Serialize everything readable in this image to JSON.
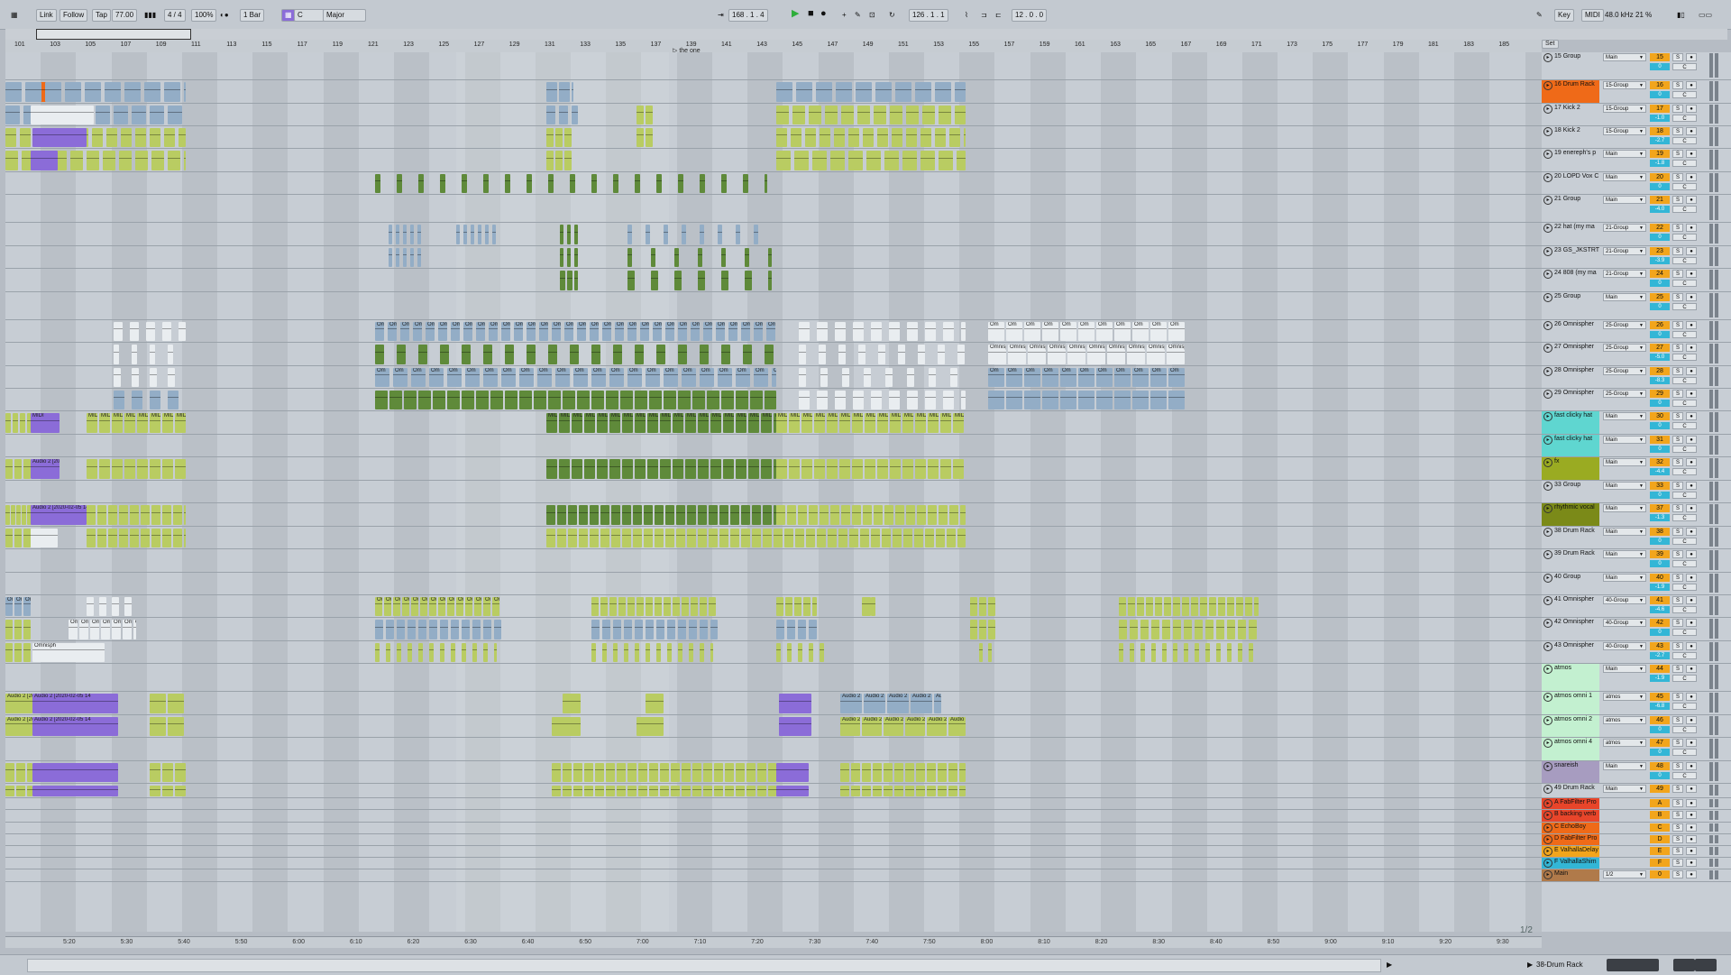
{
  "app": "Ableton Live",
  "toolbar": {
    "link": "Link",
    "follow": "Follow",
    "tap": "Tap",
    "tempo": "77.00",
    "time_sig": "4 / 4",
    "zoom": "100%",
    "quant": "1 Bar",
    "key": "C",
    "scale": "Major",
    "position": "168 . 1 . 4",
    "loop_start": "126 . 1 . 1",
    "loop_len": "12 . 0 . 0",
    "key_label": "Key",
    "midi_label": "MIDI",
    "sample_rate": "48.0 kHz",
    "cpu": "21 %"
  },
  "ruler": {
    "bars": [
      "101",
      "103",
      "105",
      "107",
      "109",
      "111",
      "113",
      "115",
      "117",
      "119",
      "121",
      "123",
      "125",
      "127",
      "129",
      "131",
      "133",
      "135",
      "137",
      "139",
      "141",
      "143",
      "145",
      "147",
      "149",
      "151",
      "153",
      "155",
      "157",
      "159",
      "161",
      "163",
      "165",
      "167",
      "169",
      "171",
      "173",
      "175",
      "177",
      "179",
      "181",
      "183",
      "185"
    ],
    "set_label": "Set",
    "marker": "the one"
  },
  "time_ruler": [
    "5:20",
    "5:30",
    "5:40",
    "5:50",
    "6:00",
    "6:10",
    "6:20",
    "6:30",
    "6:40",
    "6:50",
    "7:00",
    "7:10",
    "7:20",
    "7:30",
    "7:40",
    "7:50",
    "8:00",
    "8:10",
    "8:20",
    "8:30",
    "8:40",
    "8:50",
    "9:00",
    "9:10",
    "9:20",
    "9:30"
  ],
  "page_fraction": "1/2",
  "tracks": [
    {
      "name": "15 Group",
      "route": "Main",
      "num": "15",
      "vol": "0",
      "color": "#c8ced5"
    },
    {
      "name": "16 Drum Rack",
      "route": "15-Group",
      "num": "16",
      "vol": "0",
      "color": "#ef6a18"
    },
    {
      "name": "17 Kick 2",
      "route": "15-Group",
      "num": "17",
      "vol": "-1.0",
      "color": "#c8ced5"
    },
    {
      "name": "18 Kick 2",
      "route": "15-Group",
      "num": "18",
      "vol": "-2.7",
      "color": "#c8ced5"
    },
    {
      "name": "19 enereph's p",
      "route": "Main",
      "num": "19",
      "vol": "-1.8",
      "color": "#c8ced5"
    },
    {
      "name": "20 LOPD  Vox C",
      "route": "Main",
      "num": "20",
      "vol": "0",
      "color": "#c8ced5"
    },
    {
      "name": "21 Group",
      "route": "Main",
      "num": "21",
      "vol": "-4.0",
      "color": "#c8ced5"
    },
    {
      "name": "22 hat (my ma",
      "route": "21-Group",
      "num": "22",
      "vol": "0",
      "color": "#c8ced5"
    },
    {
      "name": "23 GS_JKSTRT",
      "route": "21-Group",
      "num": "23",
      "vol": "-3.9",
      "color": "#c8ced5"
    },
    {
      "name": "24 808 (my ma",
      "route": "21-Group",
      "num": "24",
      "vol": "0",
      "color": "#c8ced5"
    },
    {
      "name": "25 Group",
      "route": "Main",
      "num": "25",
      "vol": "0",
      "color": "#c8ced5"
    },
    {
      "name": "26 Omnispher",
      "route": "25-Group",
      "num": "26",
      "vol": "0",
      "color": "#c8ced5"
    },
    {
      "name": "27 Omnispher",
      "route": "25-Group",
      "num": "27",
      "vol": "-5.0",
      "color": "#c8ced5"
    },
    {
      "name": "28 Omnispher",
      "route": "25-Group",
      "num": "28",
      "vol": "-8.3",
      "color": "#c8ced5"
    },
    {
      "name": "29 Omnispher",
      "route": "25-Group",
      "num": "29",
      "vol": "0",
      "color": "#c8ced5"
    },
    {
      "name": "fast clicky hat",
      "route": "Main",
      "num": "30",
      "vol": "0",
      "color": "#5fd6d0"
    },
    {
      "name": "fast clicky hat",
      "route": "Main",
      "num": "31",
      "vol": "0",
      "color": "#5fd6d0"
    },
    {
      "name": "fx",
      "route": "Main",
      "num": "32",
      "vol": "-4.4",
      "color": "#9aab22"
    },
    {
      "name": "33 Group",
      "route": "Main",
      "num": "33",
      "vol": "0",
      "color": "#c8ced5"
    },
    {
      "name": "rhythmic vocal",
      "route": "Main",
      "num": "37",
      "vol": "-1.3",
      "color": "#7b8a18"
    },
    {
      "name": "38 Drum Rack",
      "route": "Main",
      "num": "38",
      "vol": "0",
      "color": "#c8ced5"
    },
    {
      "name": "39 Drum Rack",
      "route": "Main",
      "num": "39",
      "vol": "0",
      "color": "#c8ced5"
    },
    {
      "name": "40 Group",
      "route": "Main",
      "num": "40",
      "vol": "-1.9",
      "color": "#c8ced5"
    },
    {
      "name": "41 Omnispher",
      "route": "40-Group",
      "num": "41",
      "vol": "-4.6",
      "color": "#c8ced5"
    },
    {
      "name": "42 Omnispher",
      "route": "40-Group",
      "num": "42",
      "vol": "0",
      "color": "#c8ced5"
    },
    {
      "name": "43 Omnispher",
      "route": "40-Group",
      "num": "43",
      "vol": "-2.7",
      "color": "#c8ced5"
    },
    {
      "name": "atmos",
      "route": "Main",
      "num": "44",
      "vol": "-1.9",
      "color": "#c3f0d0"
    },
    {
      "name": "atmos omni 1",
      "route": "atmos",
      "num": "45",
      "vol": "-6.8",
      "color": "#c3f0d0"
    },
    {
      "name": "atmos omni 2",
      "route": "atmos",
      "num": "46",
      "vol": "0",
      "color": "#c3f0d0"
    },
    {
      "name": "atmos omni 4",
      "route": "atmos",
      "num": "47",
      "vol": "0",
      "color": "#c3f0d0"
    },
    {
      "name": "snareish",
      "route": "Main",
      "num": "48",
      "vol": "0",
      "color": "#a79cc0"
    },
    {
      "name": "49 Drum Rack",
      "route": "Main",
      "num": "49",
      "vol": "-3.2",
      "color": "#c8ced5"
    },
    {
      "name": "A FabFilter Pro",
      "route": "",
      "num": "A",
      "vol": "",
      "color": "#e8452a"
    },
    {
      "name": "B backing verb",
      "route": "",
      "num": "B",
      "vol": "",
      "color": "#e8452a"
    },
    {
      "name": "C EchoBoy",
      "route": "",
      "num": "C",
      "vol": "",
      "color": "#ef6a18"
    },
    {
      "name": "D FabFilter Pro",
      "route": "",
      "num": "D",
      "vol": "",
      "color": "#ef6a18"
    },
    {
      "name": "E ValhallaDelay",
      "route": "",
      "num": "E",
      "vol": "",
      "color": "#f2a51c"
    },
    {
      "name": "F ValhallaShim",
      "route": "",
      "num": "F",
      "vol": "",
      "color": "#33b6d6"
    },
    {
      "name": "Main",
      "route": "1/2",
      "num": "0",
      "vol": "",
      "color": "#b07a4a"
    }
  ],
  "clip_labels": {
    "midi": "MIDI",
    "audio": "Audio 2 [2020-02-05 14",
    "omni": "Omnisph",
    "omni_short": "Om"
  },
  "status": {
    "selected_track": "38-Drum Rack"
  },
  "colors": {
    "clip_green": "#b9cc62",
    "clip_dark_green": "#5f8a3a",
    "clip_blue": "#93adc6",
    "clip_purple": "#8b6cd8",
    "clip_orange": "#ef6a18",
    "track_num": "#f2a51c",
    "volume": "#33b6d6"
  }
}
